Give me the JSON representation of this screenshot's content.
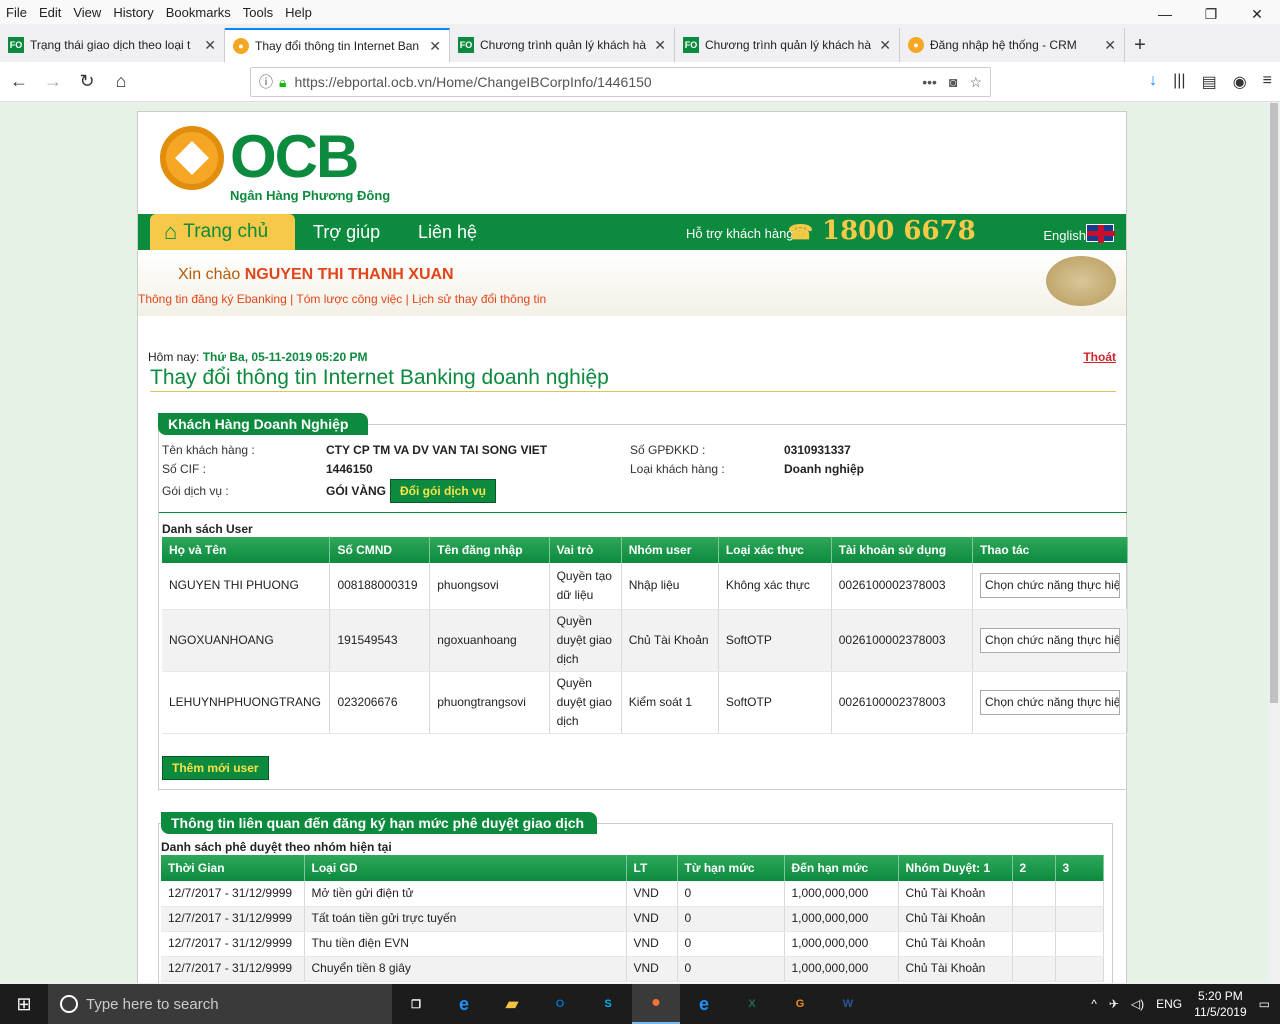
{
  "menu": [
    "File",
    "Edit",
    "View",
    "History",
    "Bookmarks",
    "Tools",
    "Help"
  ],
  "window_controls": {
    "min": "—",
    "max": "❐",
    "close": "✕"
  },
  "tabs": [
    {
      "icon": "FO",
      "title": "Trạng thái giao dịch theo loại t",
      "active": false
    },
    {
      "icon": "",
      "title": "Thay đổi thông tin Internet Ban",
      "active": true
    },
    {
      "icon": "FO",
      "title": "Chương trình quản lý khách hà",
      "active": false
    },
    {
      "icon": "FO",
      "title": "Chương trình quản lý khách hà",
      "active": false
    },
    {
      "icon": "",
      "title": "Đăng nhập hệ thống - CRM",
      "active": false
    }
  ],
  "newtab": "+",
  "url": "https://ebportal.ocb.vn/Home/ChangeIBCorpInfo/1446150",
  "brand": {
    "name": "OCB",
    "tagline": "Ngân Hàng Phương Đông"
  },
  "nav": {
    "home": "Trang chủ",
    "help": "Trợ giúp",
    "contact": "Liên hệ",
    "support": "Hỗ trợ khách hàng",
    "hotline": "1800 6678",
    "lang": "English"
  },
  "welcome": {
    "greeting": "Xin chào",
    "user": "NGUYEN THI THANH XUAN",
    "links": [
      "Thông tin đăng ký Ebanking",
      "Tóm lược công việc",
      "Lịch sử thay đổi thông tin"
    ]
  },
  "today": {
    "label": "Hôm nay:",
    "value": "Thứ Ba, 05-11-2019 05:20 PM",
    "logout": "Thoát"
  },
  "page_title": "Thay đổi thông tin Internet Banking doanh nghiệp",
  "customer": {
    "header": "Khách Hàng Doanh Nghiệp",
    "name_label": "Tên khách hàng :",
    "name": "CTY CP TM VA DV VAN TAI SONG VIET",
    "cif_label": "Số CIF :",
    "cif": "1446150",
    "pkg_label": "Gói dịch vụ :",
    "pkg": "GÓI VÀNG",
    "pkg_btn": "Đổi gói dịch vụ",
    "gpdkkd_label": "Số GPĐKKD :",
    "gpdkkd": "0310931337",
    "type_label": "Loại khách hàng :",
    "type": "Doanh nghiệp"
  },
  "users": {
    "title": "Danh sách User",
    "columns": [
      "Họ và Tên",
      "Số CMND",
      "Tên đăng nhập",
      "Vai trò",
      "Nhóm user",
      "Loại xác thực",
      "Tài khoản sử dụng",
      "Thao tác"
    ],
    "rows": [
      [
        "NGUYEN THI PHUONG",
        "008188000319",
        "phuongsovi",
        "Quyền tạo dữ liệu",
        "Nhập liệu",
        "Không xác thực",
        "0026100002378003",
        "Chọn chức năng thực hiện"
      ],
      [
        "NGOXUANHOANG",
        "191549543",
        "ngoxuanhoang",
        "Quyền duyệt giao dịch",
        "Chủ Tài Khoản",
        "SoftOTP",
        "0026100002378003",
        "Chọn chức năng thực hiện"
      ],
      [
        "LEHUYNHPHUONGTRANG",
        "023206676",
        "phuongtrangsovi",
        "Quyền duyệt giao dịch",
        "Kiểm soát 1",
        "SoftOTP",
        "0026100002378003",
        "Chọn chức năng thực hiện"
      ]
    ],
    "add_btn": "Thêm mới user"
  },
  "limits": {
    "header": "Thông tin liên quan đến đăng ký hạn mức phê duyệt giao dịch",
    "subtitle": "Danh sách phê duyệt theo nhóm hiện tại",
    "columns": [
      "Thời Gian",
      "Loại GD",
      "LT",
      "Từ hạn mức",
      "Đến hạn mức",
      "Nhóm Duyệt: 1",
      "2",
      "3"
    ],
    "rows": [
      [
        "12/7/2017 - 31/12/9999",
        "Mở tiền gửi điện tử",
        "VND",
        "0",
        "1,000,000,000",
        "Chủ Tài Khoản",
        "",
        ""
      ],
      [
        "12/7/2017 - 31/12/9999",
        "Tất toán tiền gửi trực tuyến",
        "VND",
        "0",
        "1,000,000,000",
        "Chủ Tài Khoản",
        "",
        ""
      ],
      [
        "12/7/2017 - 31/12/9999",
        "Thu tiền điện EVN",
        "VND",
        "0",
        "1,000,000,000",
        "Chủ Tài Khoản",
        "",
        ""
      ],
      [
        "12/7/2017 - 31/12/9999",
        "Chuyển tiền 8 giây",
        "VND",
        "0",
        "1,000,000,000",
        "Chủ Tài Khoản",
        "",
        ""
      ]
    ]
  },
  "taskbar": {
    "search": "Type here to search",
    "lang": "ENG",
    "time": "5:20 PM",
    "date": "11/5/2019"
  }
}
